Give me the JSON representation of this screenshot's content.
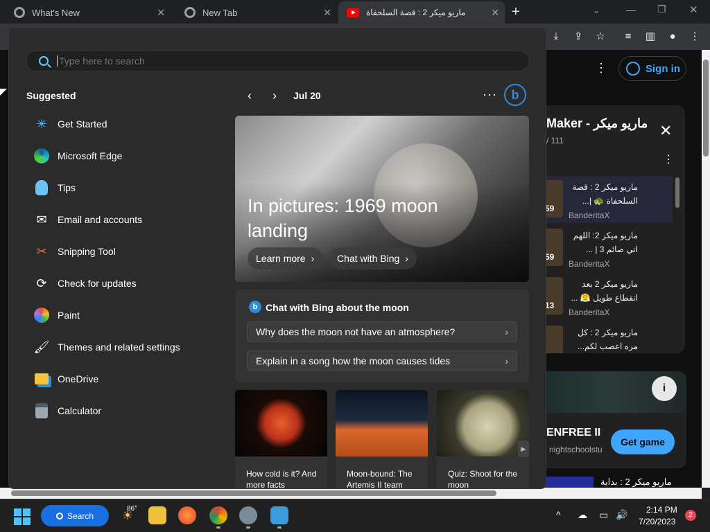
{
  "browser": {
    "tabs": [
      {
        "title": "What's New"
      },
      {
        "title": "New Tab"
      },
      {
        "title": "ماريو ميكر 2 : قصة السلحفاة"
      }
    ],
    "new_tab_symbol": "+"
  },
  "youtube": {
    "sign_in": "Sign in",
    "playlist": {
      "title": "Maker - ماريو ميكر",
      "count": "/ 111",
      "items": [
        {
          "title": "ماريو ميكر 2 : قصة السلحفاة 🐢 |...",
          "channel": "BanderitaX",
          "duration": "59"
        },
        {
          "title": "ماريو ميكر 2: اللهم اني صائم 3 | ...",
          "channel": "BanderitaX",
          "duration": "59"
        },
        {
          "title": "ماريو ميكر 2 بعد انقطاع طويل 😤 ...",
          "channel": "BanderitaX",
          "duration": "13"
        },
        {
          "title": "ماريو ميكر 2 : كل مره اعصب لكم...",
          "channel": "",
          "duration": ""
        }
      ]
    },
    "ad": {
      "name": "ENFREE II",
      "site": "nightschoolstu",
      "button": "Get game",
      "info": "i"
    },
    "bottom_title": "ماريو ميكر 2 : بداية"
  },
  "start_menu": {
    "search_placeholder": "Type here to search",
    "suggested_heading": "Suggested",
    "apps": [
      {
        "label": "Get Started",
        "icon": "get-started-icon"
      },
      {
        "label": "Microsoft Edge",
        "icon": "edge-icon"
      },
      {
        "label": "Tips",
        "icon": "tips-icon"
      },
      {
        "label": "Email and accounts",
        "icon": "email-icon"
      },
      {
        "label": "Snipping Tool",
        "icon": "snipping-tool-icon"
      },
      {
        "label": "Check for updates",
        "icon": "refresh-icon"
      },
      {
        "label": "Paint",
        "icon": "paint-icon"
      },
      {
        "label": "Themes and related settings",
        "icon": "brush-icon"
      },
      {
        "label": "OneDrive",
        "icon": "onedrive-icon"
      },
      {
        "label": "Calculator",
        "icon": "calculator-icon"
      }
    ],
    "date": "Jul 20",
    "hero": {
      "title": "In pictures: 1969 moon landing",
      "learn_more": "Learn more",
      "chat_bing": "Chat with Bing"
    },
    "chat_card": {
      "title": "Chat with Bing about the moon",
      "questions": [
        "Why does the moon not have an atmosphere?",
        "Explain in a song how the moon causes tides"
      ]
    },
    "cards": [
      {
        "caption": "How cold is it? And more facts"
      },
      {
        "caption": "Moon-bound: The Artemis II team"
      },
      {
        "caption": "Quiz: Shoot for the moon"
      }
    ]
  },
  "taskbar": {
    "search_label": "Search",
    "weather_temp": "86°",
    "time": "2:14 PM",
    "date": "7/20/2023",
    "notification_count": "2"
  },
  "colors": {
    "accent": "#60cdff",
    "bing_blue": "#2b8cd8",
    "youtube_blue": "#3ea6ff"
  }
}
